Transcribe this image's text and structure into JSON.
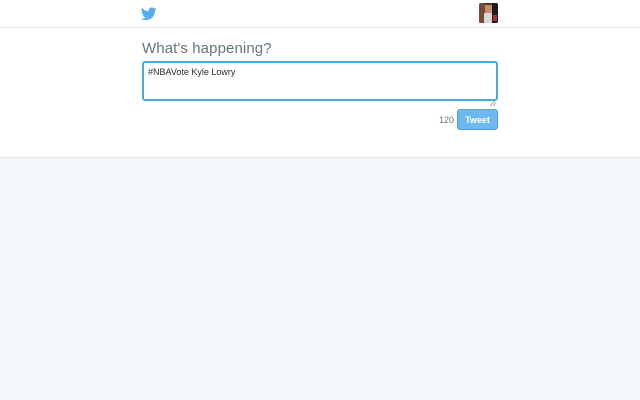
{
  "header": {
    "logo_icon": "twitter-bird-icon",
    "avatar_icon": "user-avatar"
  },
  "compose": {
    "heading": "What's happening?",
    "tweet_text": "#NBAVote Kyle Lowry",
    "char_count": "120",
    "tweet_button_label": "Tweet"
  },
  "colors": {
    "accent": "#55acee",
    "focus_border": "#4aa8e5",
    "page_background": "#f5f8fa",
    "muted_text": "#66757f"
  }
}
